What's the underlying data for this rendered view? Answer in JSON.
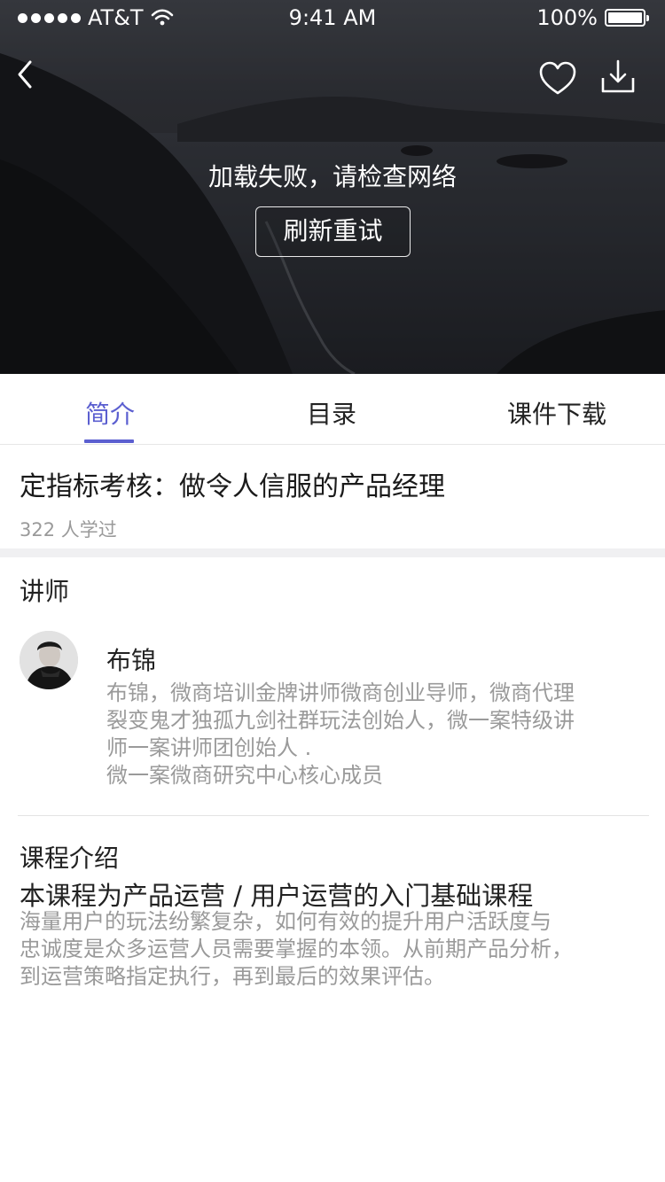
{
  "status_bar": {
    "carrier": "AT&T",
    "time": "9:41 AM",
    "battery": "100%"
  },
  "hero": {
    "error_message": "加载失败，请检查网络",
    "retry_label": "刷新重试"
  },
  "tabs": [
    {
      "label": "简介",
      "active": true
    },
    {
      "label": "目录",
      "active": false
    },
    {
      "label": "课件下载",
      "active": false
    }
  ],
  "course": {
    "title": "定指标考核：做令人信服的产品经理",
    "learners": "322 人学过"
  },
  "teacher": {
    "heading": "讲师",
    "name": "布锦",
    "bio_lines": [
      "布锦，微商培训金牌讲师微商创业导师，微商代理",
      "裂变鬼才独孤九剑社群玩法创始人，微一案特级讲",
      "师一案讲师团创始人 .",
      "微一案微商研究中心核心成员"
    ]
  },
  "intro": {
    "heading": "课程介绍",
    "subtitle": "本课程为产品运营 / 用户运营的入门基础课程",
    "body_lines": [
      "海量用户的玩法纷繁复杂，如何有效的提升用户活跃度与",
      "忠诚度是众多运营人员需要掌握的本领。从前期产品分析，",
      "到运营策略指定执行，再到最后的效果评估。"
    ]
  },
  "icons": {
    "back": "chevron-left-icon",
    "favorite": "heart-icon",
    "download": "download-icon",
    "signal": "signal-dots-icon",
    "wifi": "wifi-icon",
    "battery": "battery-icon"
  },
  "colors": {
    "accent": "#5b5fd0",
    "muted_text": "#9a9a9a",
    "section_gap": "#f0f0f2"
  }
}
